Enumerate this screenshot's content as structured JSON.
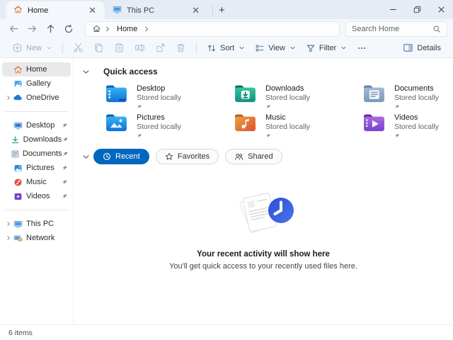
{
  "window": {
    "tabs": [
      {
        "label": "Home",
        "icon": "home-icon"
      },
      {
        "label": "This PC",
        "icon": "monitor-icon"
      }
    ]
  },
  "navbar": {
    "breadcrumb": {
      "segments": [
        "Home"
      ]
    },
    "search_placeholder": "Search Home"
  },
  "toolbar": {
    "new": "New",
    "sort": "Sort",
    "view": "View",
    "filter": "Filter",
    "details": "Details"
  },
  "sidebar": {
    "items": [
      {
        "label": "Home"
      },
      {
        "label": "Gallery"
      },
      {
        "label": "OneDrive"
      },
      {
        "label": "Desktop"
      },
      {
        "label": "Downloads"
      },
      {
        "label": "Documents"
      },
      {
        "label": "Pictures"
      },
      {
        "label": "Music"
      },
      {
        "label": "Videos"
      },
      {
        "label": "This PC"
      },
      {
        "label": "Network"
      }
    ]
  },
  "main": {
    "quick_access_title": "Quick access",
    "tiles": [
      {
        "name": "Desktop",
        "status": "Stored locally"
      },
      {
        "name": "Downloads",
        "status": "Stored locally"
      },
      {
        "name": "Documents",
        "status": "Stored locally"
      },
      {
        "name": "Pictures",
        "status": "Stored locally"
      },
      {
        "name": "Music",
        "status": "Stored locally"
      },
      {
        "name": "Videos",
        "status": "Stored locally"
      }
    ],
    "pills": [
      {
        "label": "Recent"
      },
      {
        "label": "Favorites"
      },
      {
        "label": "Shared"
      }
    ],
    "empty": {
      "title": "Your recent activity will show here",
      "subtitle": "You'll get quick access to your recently used files here."
    }
  },
  "statusbar": {
    "items_count": "6 items"
  },
  "colors": {
    "accent": "#0067c0",
    "tabbar_bg": "#e5ecf5",
    "chrome_bg": "#f4f8fc"
  }
}
